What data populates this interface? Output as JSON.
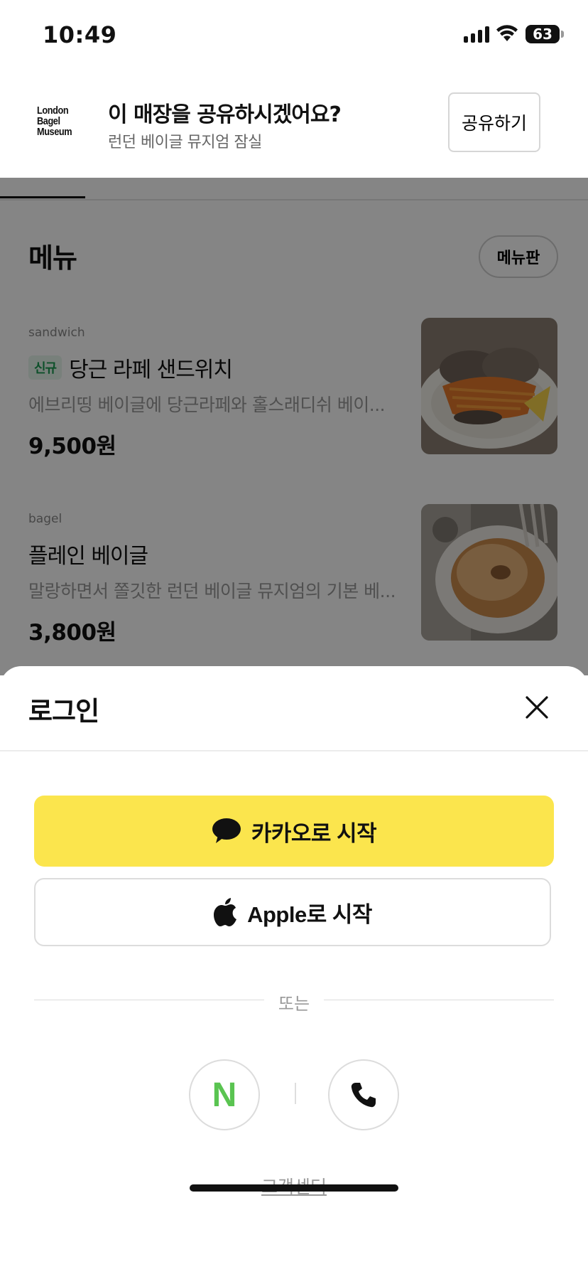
{
  "status_bar": {
    "time": "10:49",
    "battery": "63"
  },
  "share_banner": {
    "logo_lines": [
      "London",
      "Bagel",
      "Museum"
    ],
    "title": "이 매장을 공유하시겠어요?",
    "subtitle": "런던 베이글 뮤지엄 잠실",
    "share_button": "공유하기"
  },
  "menu": {
    "heading": "메뉴",
    "menuboard_button": "메뉴판",
    "items": [
      {
        "category": "sandwich",
        "badge": "신규",
        "name": "당근 라페 샌드위치",
        "description": "에브리띵 베이글에 당근라페와 홀스래디쉬 베이...",
        "price": "9,500원"
      },
      {
        "category": "bagel",
        "name": "플레인 베이글",
        "description": "말랑하면서 쫄깃한 런던 베이글 뮤지엄의 기본 베...",
        "price": "3,800원"
      }
    ]
  },
  "login_sheet": {
    "title": "로그인",
    "kakao_button": "카카오로 시작",
    "apple_button": "Apple로 시작",
    "or_text": "또는",
    "naver_letter": "N",
    "support_link": "고객센터"
  },
  "colors": {
    "kakao_yellow": "#fbe54d",
    "naver_green": "#5ac451",
    "new_badge_green": "#1a9a52"
  },
  "icons": [
    "speech-bubble-icon",
    "apple-icon",
    "close-icon",
    "phone-icon",
    "wifi-icon",
    "signal-icon",
    "battery-icon"
  ]
}
